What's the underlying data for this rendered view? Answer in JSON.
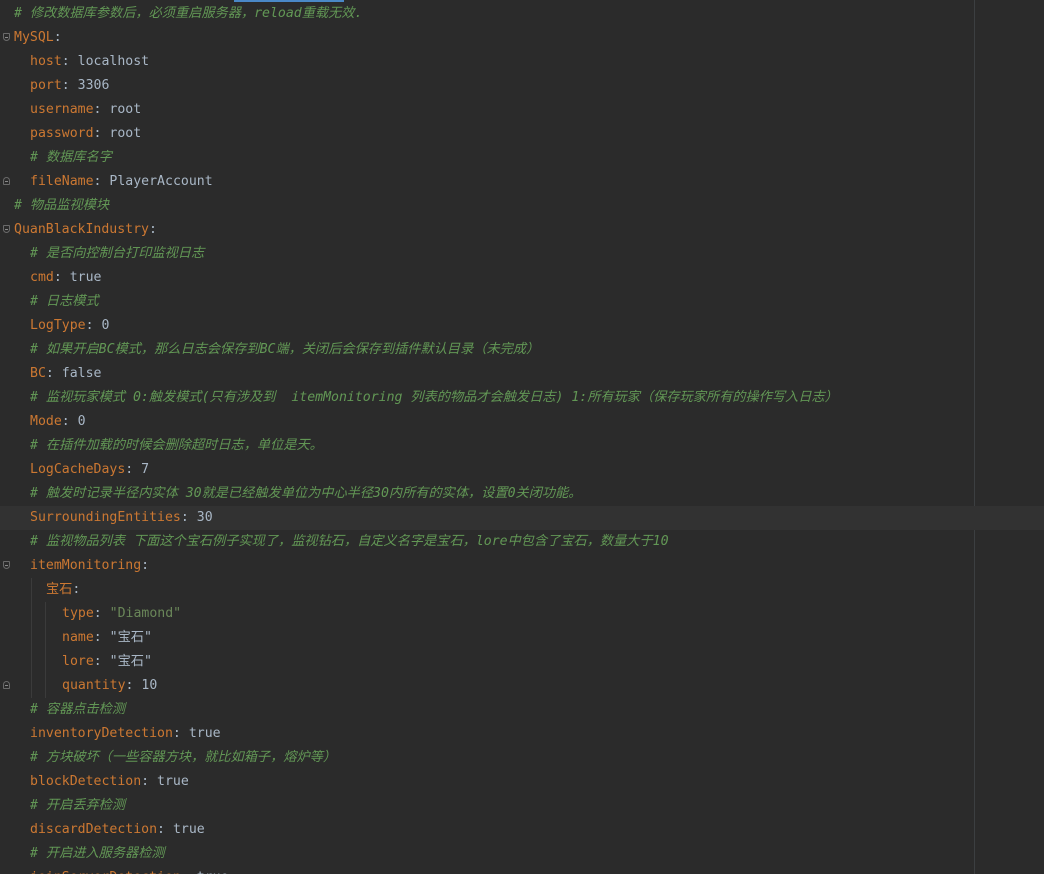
{
  "editor": {
    "lines": [
      {
        "type": "comment",
        "indent": 0,
        "text": "# 修改数据库参数后，必须重启服务器，reload重载无效."
      },
      {
        "type": "section",
        "indent": 0,
        "key": "MySQL",
        "fold": "open"
      },
      {
        "type": "kv",
        "indent": 1,
        "key": "host",
        "value": "localhost",
        "value_kind": "plain"
      },
      {
        "type": "kv",
        "indent": 1,
        "key": "port",
        "value": "3306",
        "value_kind": "plain"
      },
      {
        "type": "kv",
        "indent": 1,
        "key": "username",
        "value": "root",
        "value_kind": "plain"
      },
      {
        "type": "kv",
        "indent": 1,
        "key": "password",
        "value": "root",
        "value_kind": "plain"
      },
      {
        "type": "comment",
        "indent": 1,
        "text": "# 数据库名字"
      },
      {
        "type": "kv",
        "indent": 1,
        "key": "fileName",
        "value": "PlayerAccount",
        "value_kind": "plain",
        "fold": "close"
      },
      {
        "type": "comment",
        "indent": 0,
        "text": "# 物品监视模块"
      },
      {
        "type": "section",
        "indent": 0,
        "key": "QuanBlackIndustry",
        "fold": "open"
      },
      {
        "type": "comment",
        "indent": 1,
        "text": "# 是否向控制台打印监视日志"
      },
      {
        "type": "kv",
        "indent": 1,
        "key": "cmd",
        "value": "true",
        "value_kind": "plain"
      },
      {
        "type": "comment",
        "indent": 1,
        "text": "# 日志模式"
      },
      {
        "type": "kv",
        "indent": 1,
        "key": "LogType",
        "value": "0",
        "value_kind": "plain"
      },
      {
        "type": "comment",
        "indent": 1,
        "text": "# 如果开启BC模式，那么日志会保存到BC端，关闭后会保存到插件默认目录（未完成）"
      },
      {
        "type": "kv",
        "indent": 1,
        "key": "BC",
        "value": "false",
        "value_kind": "plain"
      },
      {
        "type": "comment",
        "indent": 1,
        "text": "# 监视玩家模式 0:触发模式(只有涉及到  itemMonitoring 列表的物品才会触发日志) 1:所有玩家（保存玩家所有的操作写入日志）"
      },
      {
        "type": "kv",
        "indent": 1,
        "key": "Mode",
        "value": "0",
        "value_kind": "plain"
      },
      {
        "type": "comment",
        "indent": 1,
        "text": "# 在插件加载的时候会删除超时日志，单位是天。"
      },
      {
        "type": "kv",
        "indent": 1,
        "key": "LogCacheDays",
        "value": "7",
        "value_kind": "plain"
      },
      {
        "type": "comment",
        "indent": 1,
        "text": "# 触发时记录半径内实体 30就是已经触发单位为中心半径30内所有的实体，设置0关闭功能。"
      },
      {
        "type": "kv",
        "indent": 1,
        "key": "SurroundingEntities",
        "value": "30",
        "value_kind": "plain",
        "current": true
      },
      {
        "type": "comment",
        "indent": 1,
        "text": "# 监视物品列表 下面这个宝石例子实现了，监视钻石，自定义名字是宝石，lore中包含了宝石，数量大于10"
      },
      {
        "type": "section",
        "indent": 1,
        "key": "itemMonitoring",
        "fold": "open"
      },
      {
        "type": "section",
        "indent": 2,
        "key": "宝石"
      },
      {
        "type": "kv",
        "indent": 3,
        "key": "type",
        "value": "\"Diamond\"",
        "value_kind": "string"
      },
      {
        "type": "kv",
        "indent": 3,
        "key": "name",
        "value": "\"宝石\"",
        "value_kind": "plain"
      },
      {
        "type": "kv",
        "indent": 3,
        "key": "lore",
        "value": "\"宝石\"",
        "value_kind": "plain"
      },
      {
        "type": "kv",
        "indent": 3,
        "key": "quantity",
        "value": "10",
        "value_kind": "plain",
        "fold": "close"
      },
      {
        "type": "comment",
        "indent": 1,
        "text": "# 容器点击检测"
      },
      {
        "type": "kv",
        "indent": 1,
        "key": "inventoryDetection",
        "value": "true",
        "value_kind": "plain"
      },
      {
        "type": "comment",
        "indent": 1,
        "text": "# 方块破坏（一些容器方块，就比如箱子，熔炉等）"
      },
      {
        "type": "kv",
        "indent": 1,
        "key": "blockDetection",
        "value": "true",
        "value_kind": "plain"
      },
      {
        "type": "comment",
        "indent": 1,
        "text": "# 开启丢弃检测"
      },
      {
        "type": "kv",
        "indent": 1,
        "key": "discardDetection",
        "value": "true",
        "value_kind": "plain"
      },
      {
        "type": "comment",
        "indent": 1,
        "text": "# 开启进入服务器检测"
      },
      {
        "type": "kv",
        "indent": 1,
        "key": "joinServerDetection",
        "value": "true",
        "value_kind": "plain"
      }
    ]
  },
  "colors": {
    "background": "#2b2b2b",
    "key": "#cc7832",
    "comment": "#629755",
    "string": "#6a8759",
    "text": "#a9b7c6",
    "current_line": "#323232"
  }
}
